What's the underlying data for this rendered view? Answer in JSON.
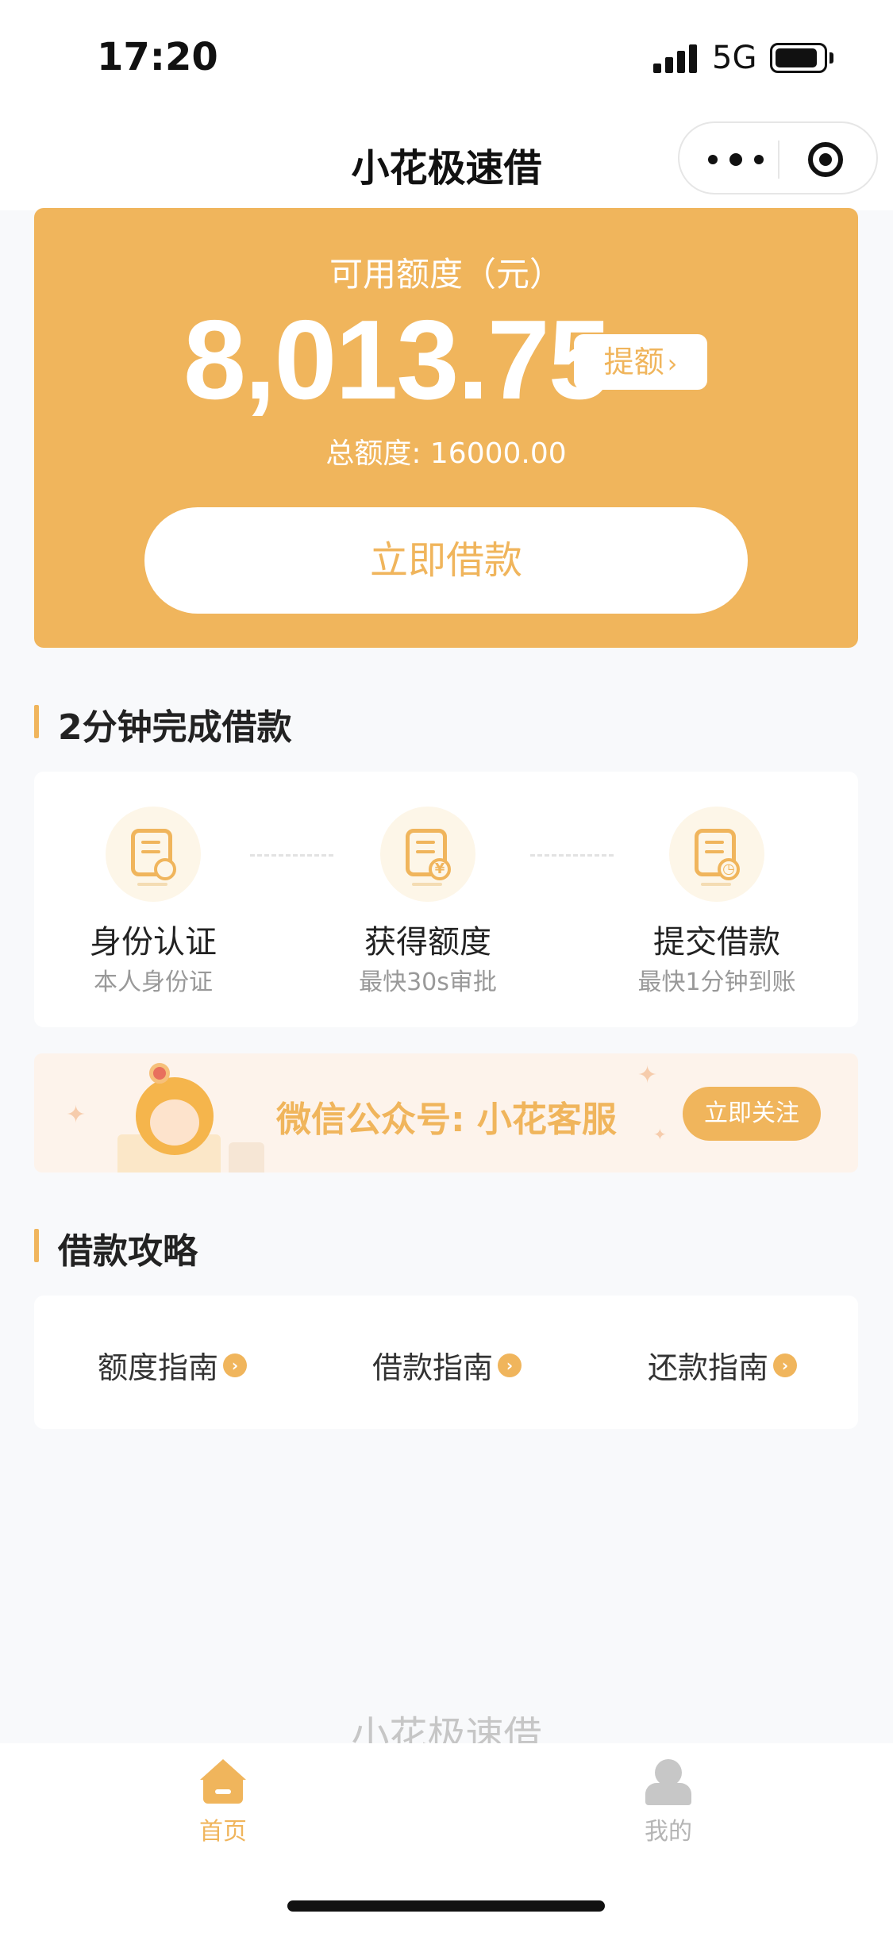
{
  "status_bar": {
    "time": "17:20",
    "network": "5G"
  },
  "nav": {
    "title": "小花极速借",
    "more_icon": "more-dots-icon",
    "close_icon": "target-circle-icon"
  },
  "credit": {
    "label": "可用额度（元）",
    "amount": "8,013.75",
    "raise_label": "提额",
    "total_label": "总额度: 16000.00",
    "borrow_label": "立即借款"
  },
  "steps_section": {
    "title": "2分钟完成借款",
    "steps": [
      {
        "name": "身份认证",
        "desc": "本人身份证",
        "icon": "id-document-icon"
      },
      {
        "name": "获得额度",
        "desc": "最快30s审批",
        "icon": "yuan-document-icon"
      },
      {
        "name": "提交借款",
        "desc": "最快1分钟到账",
        "icon": "clock-document-icon"
      }
    ]
  },
  "banner": {
    "text": "微信公众号: 小花客服",
    "button": "立即关注"
  },
  "guide_section": {
    "title": "借款攻略",
    "items": [
      {
        "label": "额度指南"
      },
      {
        "label": "借款指南"
      },
      {
        "label": "还款指南"
      }
    ]
  },
  "footer": {
    "brand": "小花极速借"
  },
  "tab_bar": {
    "tabs": [
      {
        "label": "首页",
        "icon": "home-icon",
        "active": true
      },
      {
        "label": "我的",
        "icon": "user-icon",
        "active": false
      }
    ]
  },
  "colors": {
    "accent": "#f0b55c",
    "background": "#f8f9fb",
    "muted": "#999999"
  }
}
